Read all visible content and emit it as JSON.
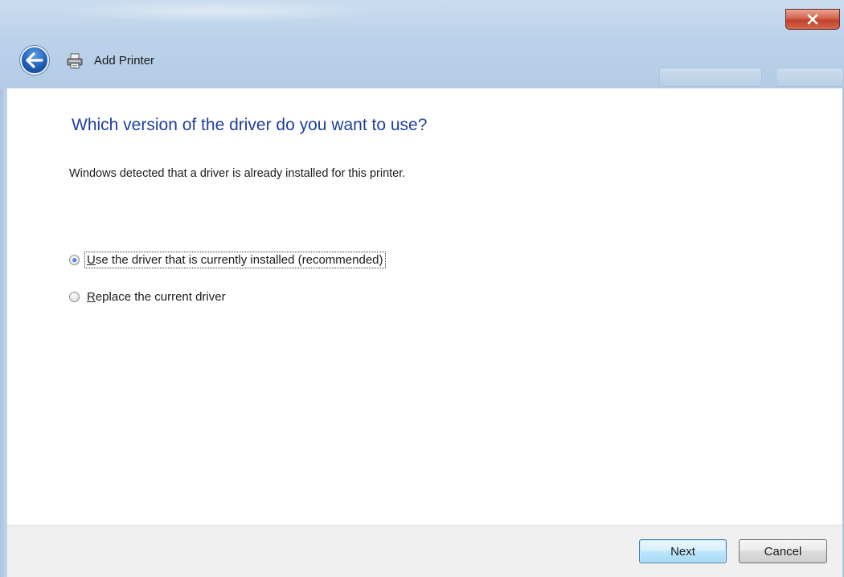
{
  "window": {
    "title": "Add Printer",
    "close_label": "close"
  },
  "icons": {
    "back": "back-arrow-icon",
    "printer": "printer-icon",
    "close": "close-icon"
  },
  "content": {
    "heading": "Which version of the driver do you want to use?",
    "description": "Windows detected that a driver is already installed for this printer.",
    "options": [
      {
        "label": "Use the driver that is currently installed (recommended)",
        "checked": true
      },
      {
        "label": "Replace the current driver",
        "checked": false
      }
    ]
  },
  "footer": {
    "next_label": "Next",
    "cancel_label": "Cancel"
  },
  "colors": {
    "heading": "#1e3f9e",
    "close_button": "#c1412a",
    "frame": "#b9cfe6"
  }
}
